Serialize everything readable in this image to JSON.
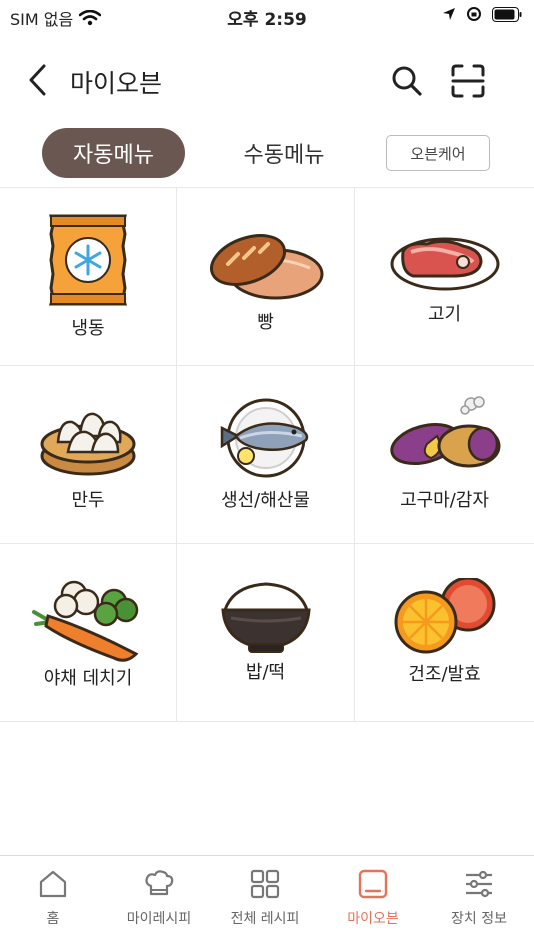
{
  "status_bar": {
    "carrier": "SIM 없음",
    "time": "오후 2:59"
  },
  "header": {
    "title": "마이오븐"
  },
  "tabs": {
    "auto_label": "자동메뉴",
    "manual_label": "수동메뉴",
    "oven_care_label": "오븐케어",
    "active": "auto"
  },
  "menu": {
    "items": [
      {
        "label": "냉동",
        "icon": "frozen-bag-icon"
      },
      {
        "label": "빵",
        "icon": "bread-icon"
      },
      {
        "label": "고기",
        "icon": "meat-icon"
      },
      {
        "label": "만두",
        "icon": "dumpling-icon"
      },
      {
        "label": "생선/해산물",
        "icon": "fish-icon"
      },
      {
        "label": "고구마/감자",
        "icon": "sweet-potato-icon"
      },
      {
        "label": "야채 데치기",
        "icon": "vegetables-icon"
      },
      {
        "label": "밥/떡",
        "icon": "rice-bowl-icon"
      },
      {
        "label": "건조/발효",
        "icon": "dried-orange-icon"
      }
    ]
  },
  "bottom_nav": {
    "items": [
      {
        "label": "홈",
        "icon": "home-icon"
      },
      {
        "label": "마이레시피",
        "icon": "chef-hat-icon"
      },
      {
        "label": "전체 레시피",
        "icon": "grid-icon"
      },
      {
        "label": "마이오븐",
        "icon": "oven-icon",
        "active": true
      },
      {
        "label": "장치 정보",
        "icon": "sliders-icon"
      }
    ]
  },
  "colors": {
    "accent": "#e5735a",
    "tab_active_bg": "#6a5751"
  }
}
